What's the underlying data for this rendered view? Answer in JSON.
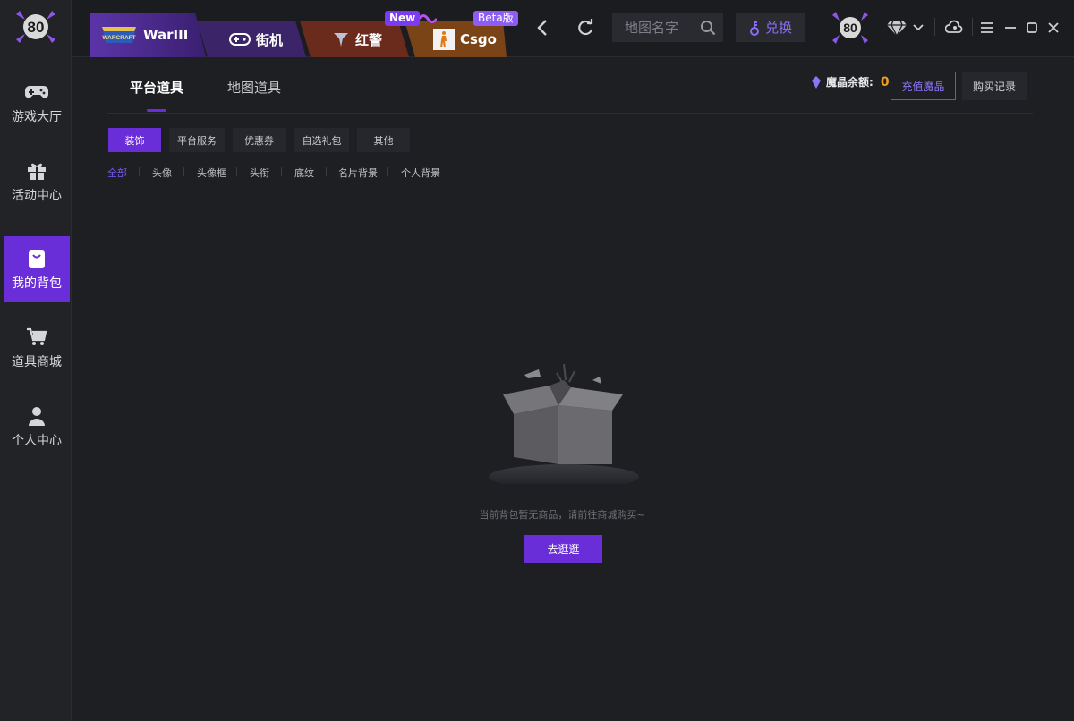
{
  "sidebar": {
    "items": [
      {
        "label": "游戏大厅",
        "icon": "gamepad-icon"
      },
      {
        "label": "活动中心",
        "icon": "gift-icon"
      },
      {
        "label": "我的背包",
        "icon": "bag-icon"
      },
      {
        "label": "道具商城",
        "icon": "cart-icon"
      },
      {
        "label": "个人中心",
        "icon": "user-icon"
      }
    ],
    "active_index": 2,
    "logo_text": "80"
  },
  "topbar": {
    "tabs": [
      {
        "label": "WarIII",
        "badge": "WARCRAFT"
      },
      {
        "label": "街机"
      },
      {
        "label": "红警"
      },
      {
        "label": "Csgo"
      }
    ],
    "tag_new": "New",
    "tag_beta": "Beta版",
    "search_placeholder": "地图名字",
    "redeem_label": "兑换",
    "avatar_text": "80"
  },
  "main": {
    "tabs": [
      {
        "label": "平台道具",
        "active": true
      },
      {
        "label": "地图道具",
        "active": false
      }
    ],
    "balance_label": "魔晶余额:",
    "balance_value": "0",
    "recharge_label": "充值魔晶",
    "history_label": "购买记录",
    "categories": [
      "装饰",
      "平台服务",
      "优惠券",
      "自选礼包",
      "其他"
    ],
    "subcategories": [
      "全部",
      "头像",
      "头像框",
      "头衔",
      "底纹",
      "名片背景",
      "个人背景"
    ],
    "empty_text": "当前背包暂无商品，请前往商城购买~",
    "go_label": "去逛逛"
  },
  "colors": {
    "accent": "#6a2ed8",
    "background": "#1e1f23",
    "balance_value": "#f0a020"
  }
}
